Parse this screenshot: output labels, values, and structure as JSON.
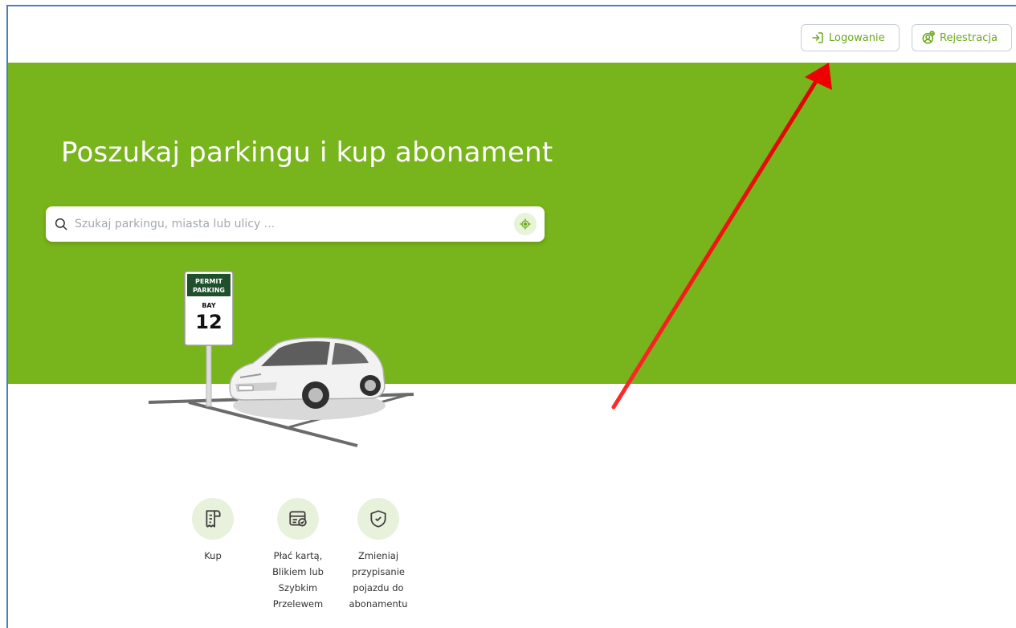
{
  "header": {
    "login_label": "Logowanie",
    "register_label": "Rejestracja"
  },
  "hero": {
    "title": "Poszukaj parkingu i kup abonament",
    "search": {
      "placeholder": "Szukaj parkingu, miasta lub ulicy ...",
      "value": ""
    }
  },
  "illustration": {
    "sign_top_line1": "PERMIT",
    "sign_top_line2": "PARKING",
    "sign_bay": "BAY",
    "sign_number": "12"
  },
  "features": [
    {
      "icon": "receipt-icon",
      "label": "Kup"
    },
    {
      "icon": "card-check-icon",
      "label": "Płać kartą, Blikiem lub Szybkim Przelewem"
    },
    {
      "icon": "shield-check-icon",
      "label": "Zmieniaj przypisanie pojazdu do abonamentu"
    }
  ],
  "colors": {
    "brand_green": "#78b41b",
    "accent_text_green": "#6aa81a",
    "annotation_arrow": "#ff0000",
    "frame_blue": "#4a7fc0"
  }
}
